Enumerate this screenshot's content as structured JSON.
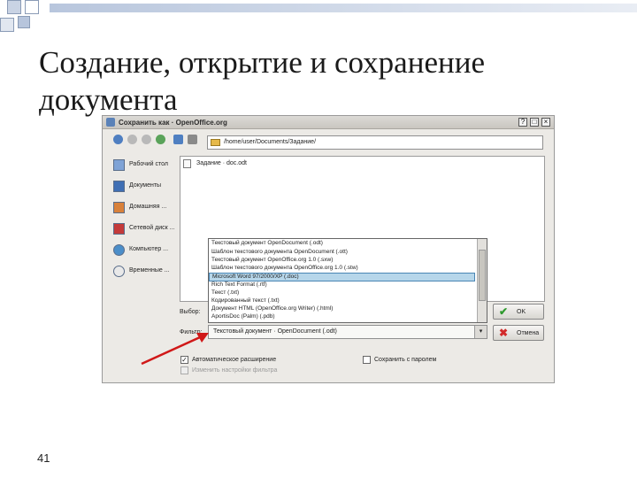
{
  "slide": {
    "title": "Создание, открытие и сохранение документа",
    "number": "41"
  },
  "dialog": {
    "title": "Сохранить как · OpenOffice.org",
    "window_buttons": [
      "?",
      "□",
      "×"
    ],
    "path": "/home/user/Documents/Задание/",
    "places": [
      {
        "icon": "desktop-icon",
        "label": "Рабочий стол"
      },
      {
        "icon": "documents-folder-icon",
        "label": "Документы"
      },
      {
        "icon": "home-folder-icon",
        "label": "Домашняя ..."
      },
      {
        "icon": "network-icon",
        "label": "Сетевой диск ..."
      },
      {
        "icon": "computer-icon",
        "label": "Компьютер ..."
      },
      {
        "icon": "recent-icon",
        "label": "Временные ..."
      }
    ],
    "files": [
      {
        "name": "Задание · doc.odt"
      }
    ],
    "file_name_label": "Выбор:",
    "filter_label": "Фильтр:",
    "filter_value": "Текстовый документ · OpenDocument (.odt)",
    "file_types": [
      {
        "label": "Текстовый документ OpenDocument (.odt)",
        "selected": false
      },
      {
        "label": "Шаблон текстового документа OpenDocument (.ott)",
        "selected": false
      },
      {
        "label": "Текстовый документ OpenOffice.org 1.0 (.sxw)",
        "selected": false
      },
      {
        "label": "Шаблон текстового документа OpenOffice.org 1.0 (.stw)",
        "selected": false
      },
      {
        "label": "Microsoft Word 97/2000/XP (.doc)",
        "selected": true
      },
      {
        "label": "Rich Text Format (.rtf)",
        "selected": false
      },
      {
        "label": "Текст (.txt)",
        "selected": false
      },
      {
        "label": "Кодированный текст (.txt)",
        "selected": false
      },
      {
        "label": "Документ HTML (OpenOffice.org Writer) (.html)",
        "selected": false
      },
      {
        "label": "AportisDoc (Palm) (.pdb)",
        "selected": false
      }
    ],
    "ok_label": "OK",
    "cancel_label": "Отмена",
    "auto_ext_label": "Автоматическое расширение",
    "auto_ext_checked": true,
    "edit_filter_label": "Изменить настройки фильтра",
    "password_label": "Сохранить с паролем",
    "password_checked": false,
    "colors": {
      "ok_icon": "#2f9a2f",
      "cancel_icon": "#d22a2a",
      "arrow": "#d01818",
      "selection": "#b6d6ea"
    }
  }
}
